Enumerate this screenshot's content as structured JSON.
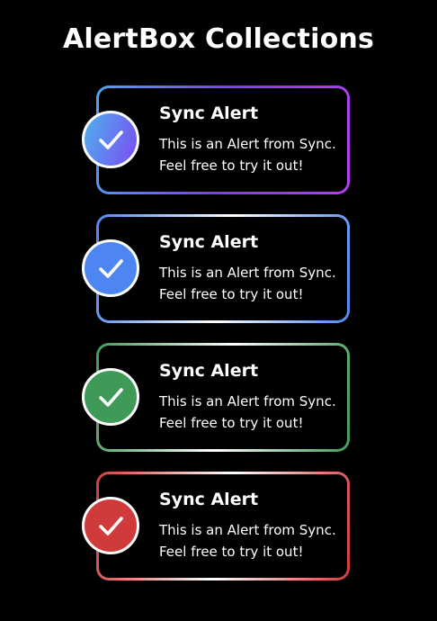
{
  "page": {
    "title": "AlertBox Collections"
  },
  "alerts": [
    {
      "title": "Sync Alert",
      "message_line1": "This is an Alert from Sync.",
      "message_line2": "Feel free to try it out!",
      "icon": "checkmark-icon",
      "style": "gradient",
      "border_colors": [
        "#4fa3f0",
        "#7a3ff0",
        "#b13ef0"
      ],
      "icon_colors": [
        "#4fb1ef",
        "#7a4cf0"
      ]
    },
    {
      "title": "Sync Alert",
      "message_line1": "This is an Alert from Sync.",
      "message_line2": "Feel free to try it out!",
      "icon": "checkmark-icon",
      "style": "info",
      "border_colors": [
        "#4d86f0",
        "#ffffff",
        "#4d86f0"
      ],
      "icon_colors": [
        "#4d86f0",
        "#4d86f0"
      ]
    },
    {
      "title": "Sync Alert",
      "message_line1": "This is an Alert from Sync.",
      "message_line2": "Feel free to try it out!",
      "icon": "checkmark-icon",
      "style": "success",
      "border_colors": [
        "#3f9a58",
        "#ffffff",
        "#3f9a58"
      ],
      "icon_colors": [
        "#3f9a58",
        "#3f9a58"
      ]
    },
    {
      "title": "Sync Alert",
      "message_line1": "This is an Alert from Sync.",
      "message_line2": "Feel free to try it out!",
      "icon": "checkmark-icon",
      "style": "danger",
      "border_colors": [
        "#d13a3a",
        "#ffffff",
        "#d13a3a"
      ],
      "icon_colors": [
        "#d13a3a",
        "#d13a3a"
      ]
    }
  ]
}
